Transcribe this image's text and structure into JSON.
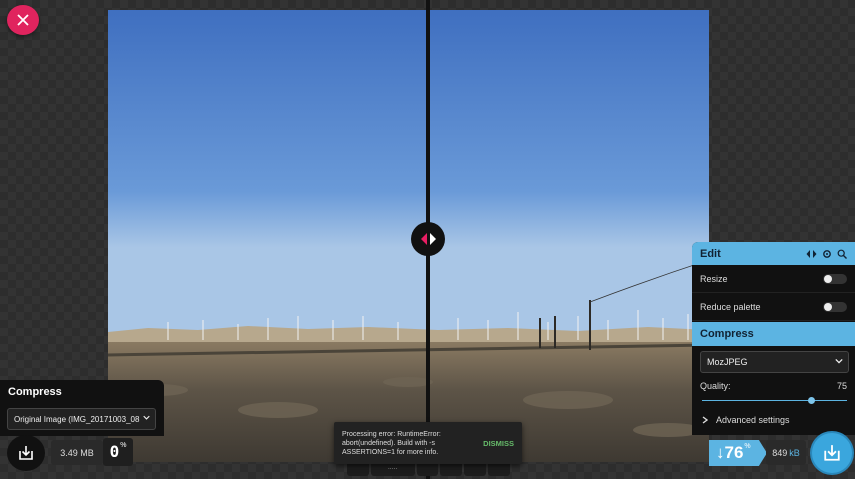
{
  "left_panel": {
    "title": "Compress",
    "source_select": "Original Image (IMG_20171003_08",
    "file_size": "3.49 MB",
    "percent": "0",
    "percent_unit": "%"
  },
  "edit_panel": {
    "title": "Edit",
    "resize_label": "Resize",
    "resize_enabled": false,
    "reduce_palette_label": "Reduce palette",
    "reduce_palette_enabled": false,
    "compress_title": "Compress",
    "codec": "MozJPEG",
    "quality_label": "Quality:",
    "quality_value": "75",
    "quality_fraction": 0.75,
    "advanced_label": "Advanced settings"
  },
  "result": {
    "savings": "76",
    "savings_arrow": "↓",
    "savings_unit": "%",
    "size_value": "849",
    "size_unit": "kB"
  },
  "toast": {
    "message": "Processing error: RuntimeError: abort(undefined). Build with -s ASSERTIONS=1 for more info.",
    "action": "DISMISS"
  },
  "zoom": {
    "value": "....."
  },
  "colors": {
    "accent_blue": "#5cb4e2",
    "close_pink": "#e0245e",
    "dismiss_green": "#66bb6a"
  },
  "icons": {
    "close": "close-icon",
    "download": "download-icon",
    "compare": "compare-icon",
    "settings": "settings-icon",
    "zoom": "zoom-icon"
  }
}
